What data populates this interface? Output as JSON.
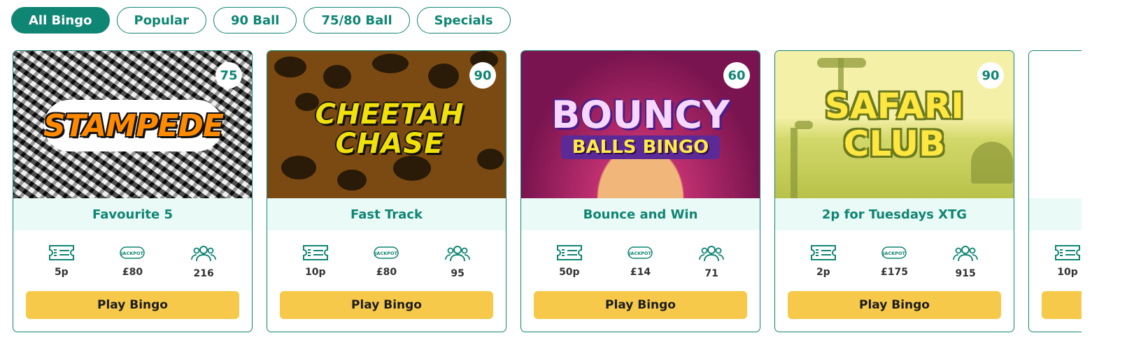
{
  "filter_tabs": [
    {
      "label": "All Bingo",
      "active": true
    },
    {
      "label": "Popular",
      "active": false
    },
    {
      "label": "90 Ball",
      "active": false
    },
    {
      "label": "75/80 Ball",
      "active": false
    },
    {
      "label": "Specials",
      "active": false
    }
  ],
  "icons": {
    "ticket": "ticket-icon",
    "jackpot": "jackpot-icon",
    "players": "players-icon"
  },
  "colors": {
    "primary": "#0f8573",
    "play_button": "#f6c94a",
    "name_strip": "#eafaf6"
  },
  "cards": [
    {
      "thumb_title": "STAMPEDE",
      "ball_type": "75",
      "name": "Favourite 5",
      "ticket_price": "5p",
      "jackpot": "£80",
      "players": "216",
      "button_label": "Play Bingo"
    },
    {
      "thumb_title": "CHEETAH CHASE",
      "ball_type": "90",
      "name": "Fast Track",
      "ticket_price": "10p",
      "jackpot": "£80",
      "players": "95",
      "button_label": "Play Bingo"
    },
    {
      "thumb_title": "BOUNCY",
      "thumb_subtitle": "BALLS BINGO",
      "ball_type": "60",
      "name": "Bounce and Win",
      "ticket_price": "50p",
      "jackpot": "£14",
      "players": "71",
      "button_label": "Play Bingo"
    },
    {
      "thumb_title": "SAFARI CLUB",
      "ball_type": "90",
      "name": "2p for Tuesdays XTG",
      "ticket_price": "2p",
      "jackpot": "£175",
      "players": "915",
      "button_label": "Play Bingo"
    },
    {
      "ticket_price": "10p"
    }
  ],
  "jackpot_icon_text": "JACKPOT"
}
